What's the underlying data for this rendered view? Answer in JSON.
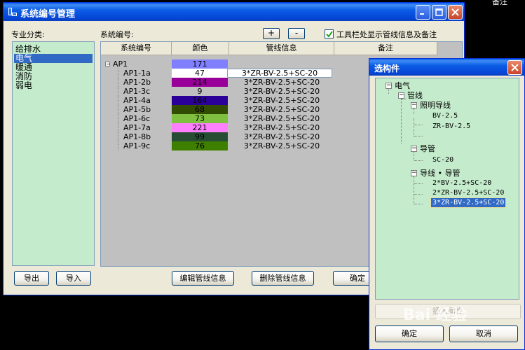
{
  "corner_text": "备注",
  "main_window": {
    "title": "系统编号管理",
    "category_label": "专业分类:",
    "categories": [
      "给排水",
      "电气",
      "暖通",
      "消防",
      "弱电"
    ],
    "selected_category_index": 1,
    "system_number_label": "系统编号:",
    "add_label": "+",
    "remove_label": "-",
    "toolbar_checkbox_label": "工具栏处显示管线信息及备注",
    "grid_headers": [
      "系统编号",
      "颜色",
      "管线信息",
      "备注"
    ],
    "rows": [
      {
        "id": "AP1",
        "color_num": "171",
        "color": "#8080ff",
        "pipe": "",
        "level": 0
      },
      {
        "id": "AP1-1a",
        "color_num": "47",
        "color": "#ffffff",
        "pipe": "3*ZR-BV-2.5+SC-20",
        "level": 1,
        "editing": true
      },
      {
        "id": "AP1-2b",
        "color_num": "214",
        "color": "#990099",
        "pipe": "3*ZR-BV-2.5+SC-20",
        "level": 1
      },
      {
        "id": "AP1-3c",
        "color_num": "9",
        "color": "#c0c0c0",
        "pipe": "3*ZR-BV-2.5+SC-20",
        "level": 1
      },
      {
        "id": "AP1-4a",
        "color_num": "164",
        "color": "#2a0099",
        "pipe": "3*ZR-BV-2.5+SC-20",
        "level": 1
      },
      {
        "id": "AP1-5b",
        "color_num": "68",
        "color": "#334d00",
        "pipe": "3*ZR-BV-2.5+SC-20",
        "level": 1
      },
      {
        "id": "AP1-6c",
        "color_num": "73",
        "color": "#80c040",
        "pipe": "3*ZR-BV-2.5+SC-20",
        "level": 1
      },
      {
        "id": "AP1-7a",
        "color_num": "221",
        "color": "#ff80ff",
        "pipe": "3*ZR-BV-2.5+SC-20",
        "level": 1
      },
      {
        "id": "AP1-8b",
        "color_num": "99",
        "color": "#264d33",
        "pipe": "3*ZR-BV-2.5+SC-20",
        "level": 1
      },
      {
        "id": "AP1-9c",
        "color_num": "76",
        "color": "#3f7f00",
        "pipe": "3*ZR-BV-2.5+SC-20",
        "level": 1
      }
    ],
    "export_label": "导出",
    "import_label": "导入",
    "edit_pipe_label": "编辑管线信息",
    "delete_pipe_label": "删除管线信息",
    "ok_label": "确定"
  },
  "dialog": {
    "title": "选构件",
    "tree": {
      "electric": "电气",
      "pipe": "管线",
      "lighting_wire": "照明导线",
      "wire1": "BV-2.5",
      "wire2": "ZR-BV-2.5",
      "conduit": "导管",
      "conduit1": "SC-20",
      "wire_conduit": "导线 • 导管",
      "combo1": "2*BV-2.5+SC-20",
      "combo2": "2*ZR-BV-2.5+SC-20",
      "combo3": "3*ZR-BV-2.5+SC-20"
    },
    "disabled_button_label": "插入属性",
    "ok_label": "确定",
    "cancel_label": "取消"
  },
  "watermark": "Bai 经验"
}
